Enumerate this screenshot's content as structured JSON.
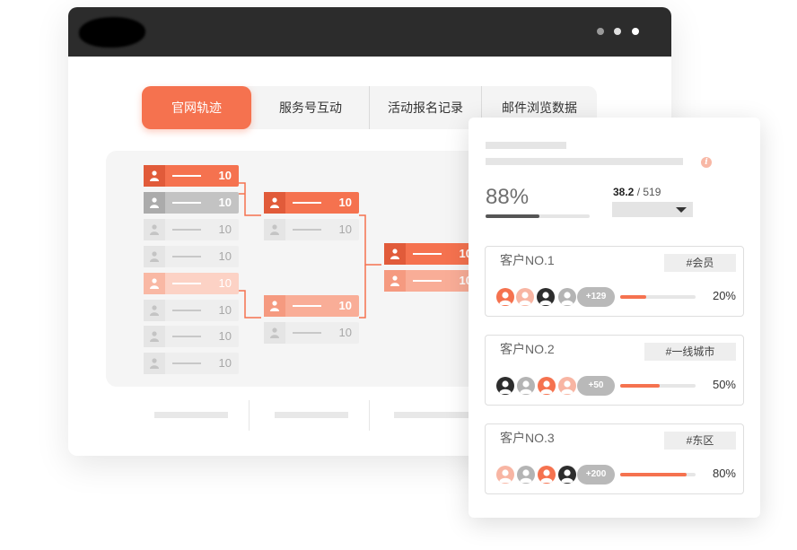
{
  "colors": {
    "accent": "#f5724f",
    "titlebar": "#2c2c2c",
    "dark_avatar": "#2d2d2d",
    "gray_avatar": "#b4b4b4",
    "light_avatar": "#f8b5a3"
  },
  "window": {
    "control_icons": [
      "dot-icon",
      "dot-icon",
      "dot-icon"
    ]
  },
  "tabs": [
    {
      "label": "官网轨迹",
      "active": true
    },
    {
      "label": "服务号互动",
      "active": false
    },
    {
      "label": "活动报名记录",
      "active": false
    },
    {
      "label": "邮件浏览数据",
      "active": false
    }
  ],
  "tree": {
    "node_icon": "user-icon",
    "nodes": [
      {
        "value": "10",
        "style": "primary"
      },
      {
        "value": "10",
        "style": "muted"
      },
      {
        "value": "10",
        "style": "faded"
      },
      {
        "value": "10",
        "style": "faded"
      },
      {
        "value": "10",
        "style": "light"
      },
      {
        "value": "10",
        "style": "faded"
      },
      {
        "value": "10",
        "style": "faded"
      },
      {
        "value": "10",
        "style": "faded"
      },
      {
        "value": "10",
        "style": "primary"
      },
      {
        "value": "10",
        "style": "faded"
      },
      {
        "value": "10",
        "style": "medium"
      },
      {
        "value": "10",
        "style": "faded"
      },
      {
        "value": "10",
        "style": "primary"
      },
      {
        "value": "10",
        "style": "medium"
      }
    ]
  },
  "panel": {
    "info_icon": "info-icon",
    "percent_label": "88%",
    "percent_value": 0.52,
    "ratio_value": "38.2",
    "ratio_total": "/ 519",
    "dropdown_icon": "caret-down-icon",
    "customers": [
      {
        "title": "客户NO.1",
        "tag": "#会员",
        "more": "+129",
        "percent_label": "20%",
        "fill": 0.35,
        "avatars": [
          "salmon",
          "light",
          "dark",
          "gray"
        ]
      },
      {
        "title": "客户NO.2",
        "tag": "#一线城市",
        "more": "+50",
        "percent_label": "50%",
        "fill": 0.52,
        "avatars": [
          "dark",
          "gray",
          "salmon",
          "light"
        ]
      },
      {
        "title": "客户NO.3",
        "tag": "#东区",
        "more": "+200",
        "percent_label": "80%",
        "fill": 0.88,
        "avatars": [
          "light",
          "gray",
          "salmon",
          "dark"
        ]
      }
    ]
  }
}
